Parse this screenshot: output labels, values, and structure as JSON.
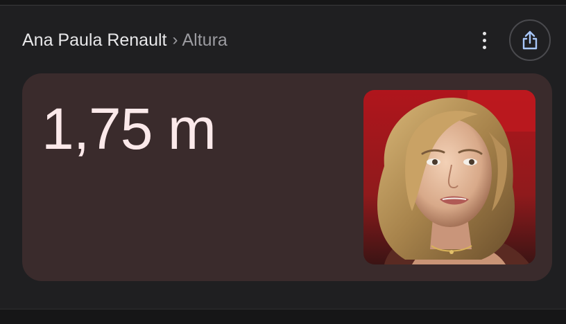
{
  "breadcrumb": {
    "parent": "Ana Paula Renault",
    "separator": "›",
    "current": "Altura"
  },
  "actions": {
    "more_icon": "more-vert-icon",
    "share_icon": "share-icon"
  },
  "result": {
    "value": "1,75 m"
  },
  "colors": {
    "background": "#1f1f21",
    "card": "#3a2b2c",
    "value_text": "#fbe9ea",
    "share_accent": "#a8c7fa"
  }
}
